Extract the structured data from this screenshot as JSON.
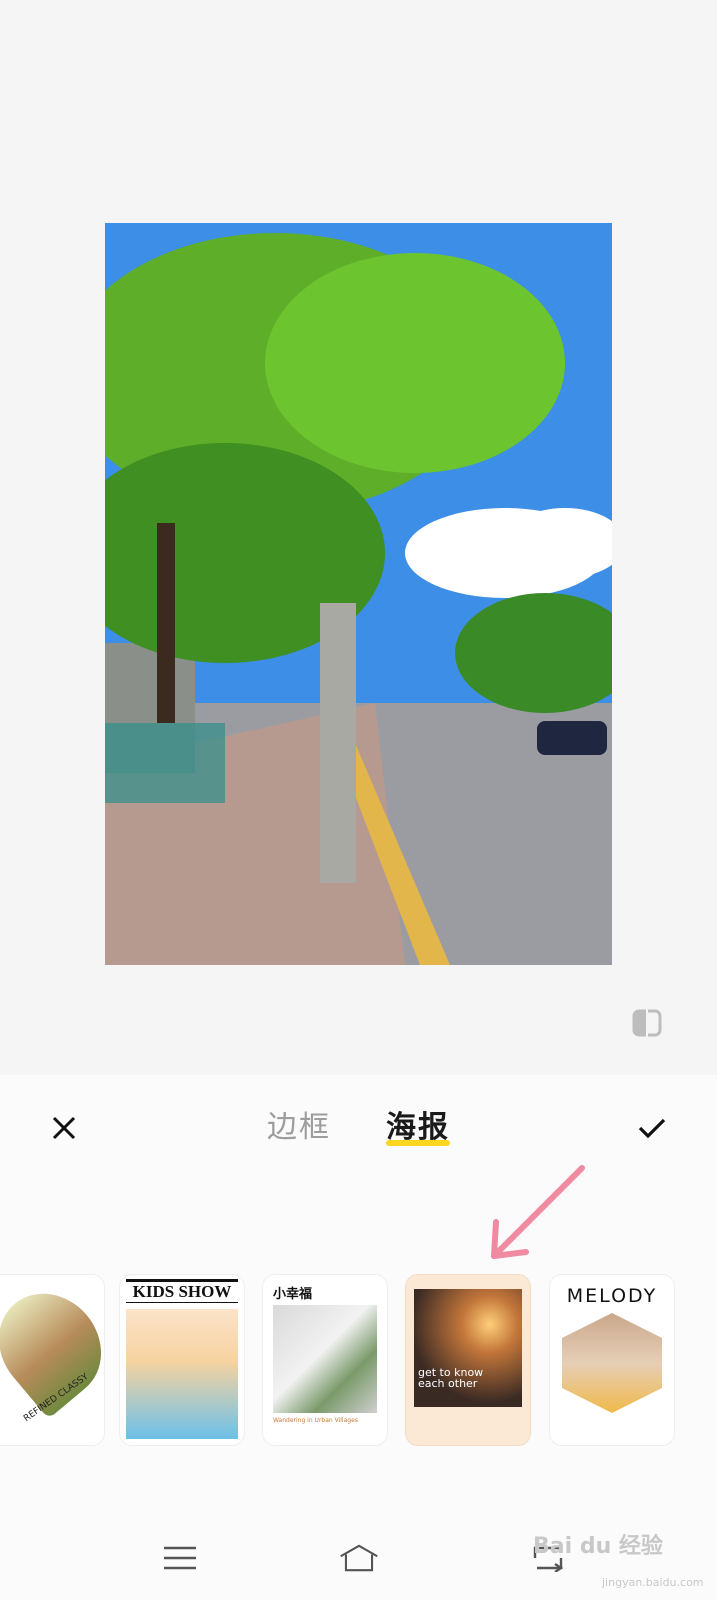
{
  "editor": {
    "tabs": [
      {
        "label": "边框",
        "active": false
      },
      {
        "label": "海报",
        "active": true
      }
    ],
    "accent_color": "#ffd61f"
  },
  "templates": [
    {
      "name": "classy",
      "text": "REFINED CLASSY"
    },
    {
      "name": "kids-show",
      "title": "KIDS SHOW"
    },
    {
      "name": "xiao-xing-fu",
      "heading": "小幸福",
      "caption": "Wandering in Urban Villages"
    },
    {
      "name": "get-to-know",
      "text": "get to know each other",
      "selected": true
    },
    {
      "name": "melody",
      "title": "MELODY"
    }
  ],
  "watermark": {
    "brand": "Bai du 经验",
    "site": "jingyan.baidu.com"
  },
  "icons": {
    "close": "close-icon",
    "confirm": "check-icon",
    "compare": "compare-icon",
    "nav_menu": "menu-icon",
    "nav_home": "home-icon",
    "nav_back": "back-icon"
  }
}
